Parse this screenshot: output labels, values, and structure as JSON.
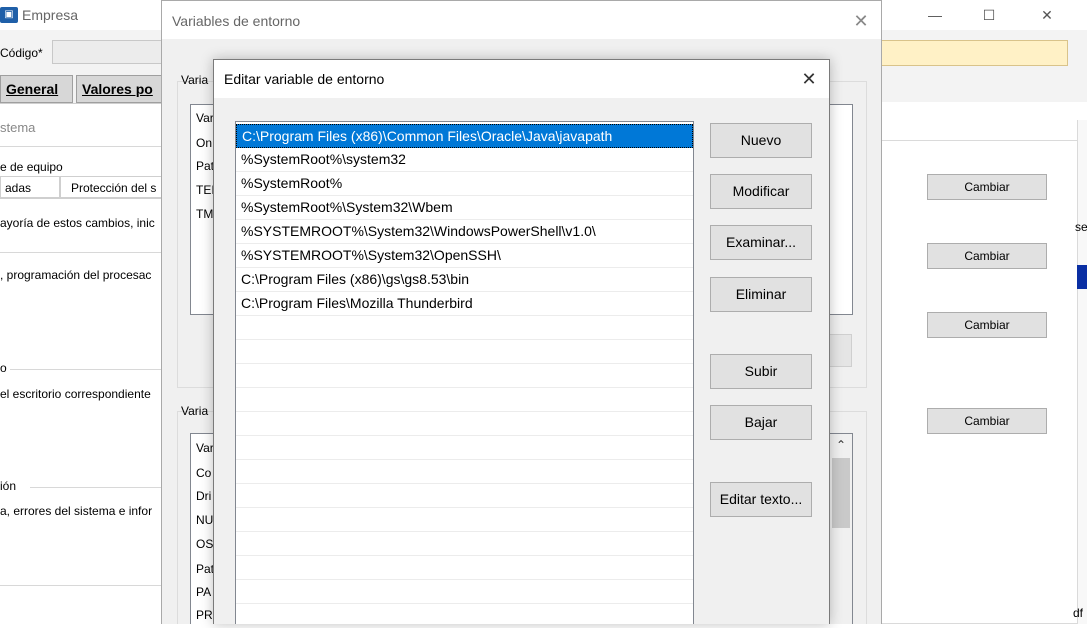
{
  "background_window": {
    "title": "Empresa",
    "codigo_label": "Código*",
    "tabs": [
      "General",
      "Valores po"
    ],
    "system_props": {
      "title": "stema",
      "line_computer": "e de equipo",
      "tabs": [
        "adas",
        "Protección del s"
      ],
      "text_performance": "ayoría de estos cambios, inic",
      "text_processor": ", programación del procesac",
      "section_profile": "o",
      "text_profile": "el escritorio correspondiente",
      "section_startup": "ión",
      "text_startup": "a, errores del sistema e infor",
      "cambiar_buttons": [
        "Cambiar",
        "Cambiar",
        "Cambiar",
        "Cambiar"
      ],
      "edge_text_se": "se",
      "edge_text_df": "df"
    }
  },
  "env_dialog": {
    "title": "Variables de entorno",
    "user_group_label": "Varia",
    "user_vars": [
      "Var",
      "On",
      "Pat",
      "TEI",
      "TM"
    ],
    "system_group_label": "Varia",
    "system_vars": [
      "Var",
      "Co",
      "Dri",
      "NU",
      "OS",
      "Pat",
      "PA",
      "PR"
    ]
  },
  "edit_dialog": {
    "title": "Editar variable de entorno",
    "paths": [
      "C:\\Program Files (x86)\\Common Files\\Oracle\\Java\\javapath",
      "%SystemRoot%\\system32",
      "%SystemRoot%",
      "%SystemRoot%\\System32\\Wbem",
      "%SYSTEMROOT%\\System32\\WindowsPowerShell\\v1.0\\",
      "%SYSTEMROOT%\\System32\\OpenSSH\\",
      "C:\\Program Files (x86)\\gs\\gs8.53\\bin",
      "C:\\Program Files\\Mozilla Thunderbird"
    ],
    "selected_index": 0,
    "buttons": {
      "nuevo": "Nuevo",
      "modificar": "Modificar",
      "examinar": "Examinar...",
      "eliminar": "Eliminar",
      "subir": "Subir",
      "bajar": "Bajar",
      "editar_texto": "Editar texto..."
    }
  },
  "glyphs": {
    "close": "✕",
    "minimize": "—",
    "maximize": "☐",
    "scroll_up": "⌃"
  }
}
